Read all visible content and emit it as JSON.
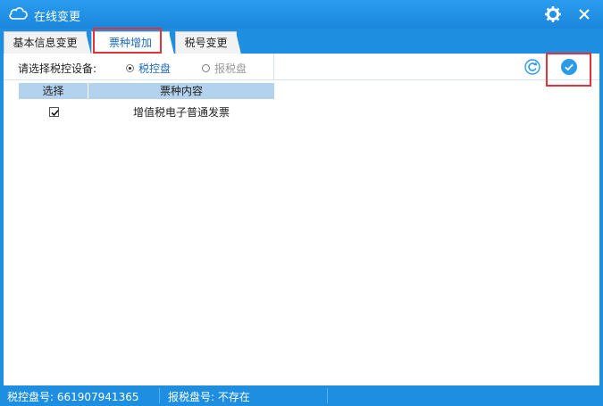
{
  "window": {
    "title": "在线变更",
    "icons": {
      "app": "cloud-icon",
      "settings": "settings-icon",
      "close": "close-icon"
    }
  },
  "tabs": [
    {
      "label": "基本信息变更",
      "active": false
    },
    {
      "label": "票种增加",
      "active": true
    },
    {
      "label": "税号变更",
      "active": false
    }
  ],
  "toolbar": {
    "device_label": "请选择税控设备:",
    "options": [
      {
        "label": "税控盘",
        "selected": true
      },
      {
        "label": "报税盘",
        "selected": false
      }
    ],
    "icons": {
      "refresh": "refresh-icon",
      "confirm": "confirm-check-icon"
    }
  },
  "table": {
    "columns": [
      "选择",
      "票种内容"
    ],
    "rows": [
      {
        "checked": true,
        "content": "增值税电子普通发票"
      }
    ]
  },
  "status": {
    "tax_disk_no": "税控盘号: 661907941365",
    "report_disk_no": "报税盘号: 不存在"
  },
  "colors": {
    "frame": "#1e8fe0",
    "header_cell": "#b3d2ee",
    "highlight": "#e0343a",
    "accent": "#1e6ab8"
  }
}
